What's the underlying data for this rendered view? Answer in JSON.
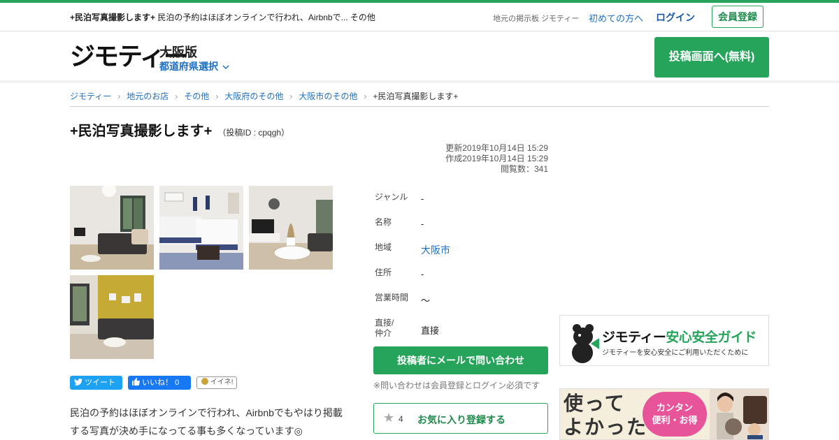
{
  "topbar": {
    "lead_bold": "+民泊写真撮影します+",
    "lead_text": "民泊の予約はほぼオンラインで行われ、Airbnbで... その他",
    "meta": "地元の掲示板 ジモティー",
    "first_time": "初めての方へ",
    "login": "ログイン",
    "signup": "会員登録"
  },
  "header": {
    "logo": "ジモティー",
    "region": "大阪版",
    "pref_select": "都道府県選択",
    "post_button": "投稿画面へ(無料)"
  },
  "breadcrumb": [
    "ジモティー",
    "地元のお店",
    "その他",
    "大阪府のその他",
    "大阪市のその他",
    "+民泊写真撮影します+"
  ],
  "post": {
    "title": "+民泊写真撮影します+",
    "post_id": "（投稿ID : cpqgh）",
    "updated": "更新2019年10月14日 15:29",
    "created": "作成2019年10月14日 15:29",
    "views": "閲覧数：341"
  },
  "info": [
    {
      "key": "ジャンル",
      "value": "-"
    },
    {
      "key": "名称",
      "value": "-"
    },
    {
      "key": "地域",
      "value": "大阪市"
    },
    {
      "key": "住所",
      "value": "-"
    },
    {
      "key": "営業時間",
      "value": "〜"
    },
    {
      "key": "直接/\n仲介",
      "value": "直接"
    }
  ],
  "actions": {
    "contact": "投稿者にメールで問い合わせ",
    "note": "※問い合わせは会員登録とログイン必須です",
    "fav_count": "4",
    "fav_label": "お気に入り登録する"
  },
  "share": {
    "tweet": "ツイート",
    "like": "いいね！ 0",
    "iine": "イイネ!"
  },
  "description": "民泊の予約はほぼオンラインで行われ、Airbnbでもやはり掲載する写真が決め手になってる事も多くなっています◎",
  "guide": {
    "brand": "ジモティー",
    "title": "安心安全ガイド",
    "subtitle": "ジモティーを安心安全にご利用いただくために"
  },
  "ad": {
    "big_line1": "使って",
    "big_line2": "よかった",
    "bubble_line1": "カンタン",
    "bubble_line2": "便利・お得"
  },
  "colors": {
    "accent": "#27a45c",
    "link": "#1a6fc4"
  }
}
